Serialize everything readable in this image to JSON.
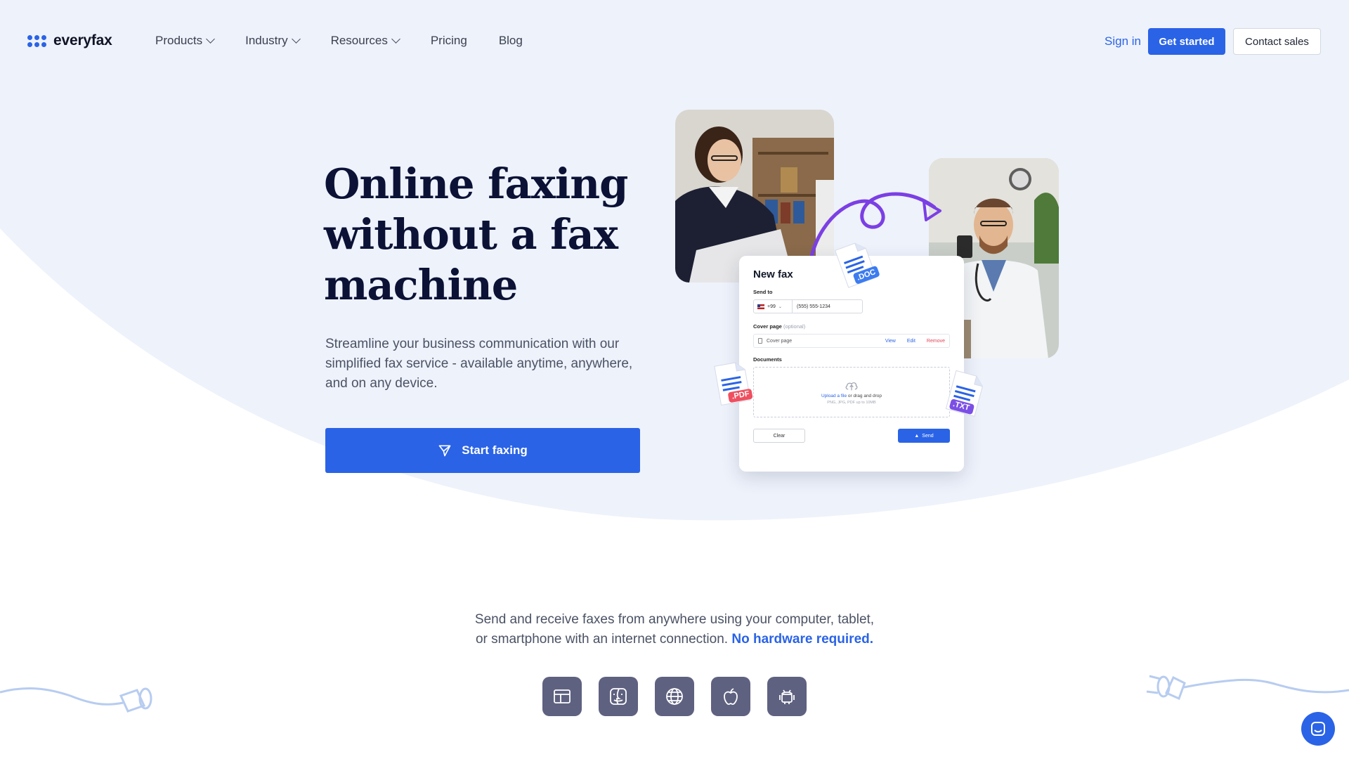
{
  "brand": {
    "name": "everyfax",
    "accent": "#2a63e6",
    "heading_color": "#0b1236"
  },
  "nav": {
    "items": [
      {
        "label": "Products",
        "has_dropdown": true
      },
      {
        "label": "Industry",
        "has_dropdown": true
      },
      {
        "label": "Resources",
        "has_dropdown": true
      },
      {
        "label": "Pricing",
        "has_dropdown": false
      },
      {
        "label": "Blog",
        "has_dropdown": false
      }
    ],
    "sign_in": "Sign in",
    "get_started": "Get started",
    "contact_sales": "Contact sales"
  },
  "hero": {
    "title_line1": "Online faxing",
    "title_line2": "without a fax",
    "title_line3": "machine",
    "subtitle": "Streamline your business communication with our simplified fax service - available anytime, anywhere, and on any device.",
    "cta": "Start faxing",
    "cta_icon": "send-icon"
  },
  "fax_card": {
    "title": "New fax",
    "send_to_label": "Send to",
    "country_code": "+99",
    "phone": "(555) 555-1234",
    "cover_page_label": "Cover page",
    "cover_page_optional": "(optional)",
    "cover_file": "Cover page",
    "view": "View",
    "edit": "Edit",
    "remove": "Remove",
    "documents_label": "Documents",
    "upload_link": "Upload a file",
    "upload_rest": " or drag and drop",
    "upload_hint": "PNG, JPG, PDF up to 10MB",
    "clear": "Clear",
    "send": "Send"
  },
  "file_badges": [
    ".DOC",
    ".PDF",
    ".TXT"
  ],
  "lower": {
    "text_line1": "Send and receive faxes from anywhere using your computer, tablet,",
    "text_line2": "or smartphone with an internet connection.",
    "highlight": "No hardware required.",
    "platforms": [
      "windows-icon",
      "macos-finder-icon",
      "web-globe-icon",
      "apple-icon",
      "android-icon"
    ]
  },
  "chat": {
    "icon": "chat-icon"
  }
}
